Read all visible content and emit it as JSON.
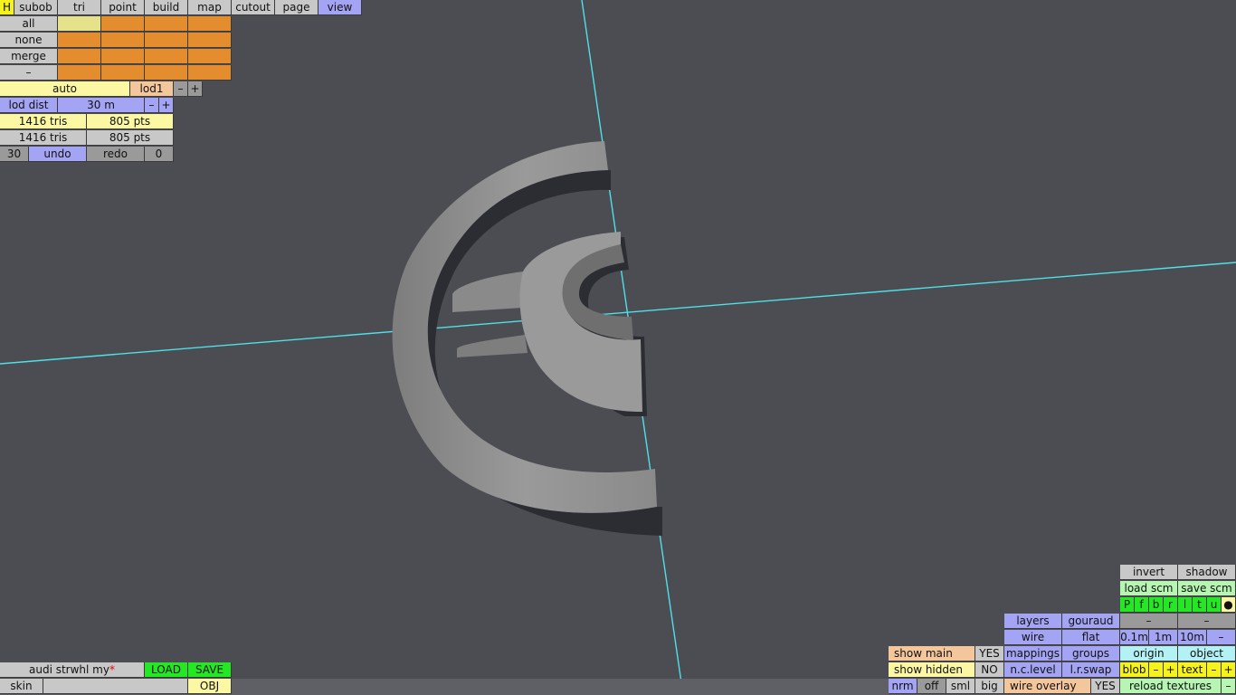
{
  "colors": {
    "viewport_bg": "#4b4d53",
    "axis_line": "#4fe0e8",
    "model": "#8f8f8f"
  },
  "top_menu": {
    "items": [
      "H",
      "subob",
      "tri",
      "point",
      "build",
      "map",
      "cutout",
      "page",
      "view"
    ],
    "active": "view"
  },
  "selection": {
    "rows": [
      "all",
      "none",
      "merge",
      "–"
    ]
  },
  "lod": {
    "mode": "auto",
    "level": "lod1",
    "minus": "–",
    "plus": "+",
    "dist_label": "lod dist",
    "dist_value": "30 m",
    "dist_minus": "–",
    "dist_plus": "+"
  },
  "stats": {
    "row1_tris": "1416 tris",
    "row1_pts": "805 pts",
    "row2_tris": "1416 tris",
    "row2_pts": "805 pts"
  },
  "history": {
    "undo_count": "30",
    "undo": "undo",
    "redo": "redo",
    "redo_count": "0"
  },
  "file": {
    "name": "audi strwhl my",
    "modified_marker": "*",
    "load": "LOAD",
    "save": "SAVE",
    "skin_label": "skin",
    "skin_value": "",
    "format": "OBJ"
  },
  "view_panel": {
    "invert": "invert",
    "shadow": "shadow",
    "load_scm": "load scm",
    "save_scm": "save scm",
    "cams": [
      "P",
      "f",
      "b",
      "r",
      "l",
      "t",
      "u",
      "●"
    ],
    "dash1": "–",
    "dash2": "–",
    "layers": "layers",
    "gouraud": "gouraud",
    "wire": "wire",
    "flat": "flat",
    "grid": [
      "0.1m",
      "1m",
      "10m",
      "–"
    ],
    "show_main": "show main",
    "show_main_val": "YES",
    "mappings": "mappings",
    "groups": "groups",
    "origin": "origin",
    "object": "object",
    "show_hidden": "show hidden",
    "show_hidden_val": "NO",
    "nc_level": "n.c.level",
    "lr_swap": "l.r.swap",
    "blob": "blob",
    "blob_minus": "–",
    "blob_plus": "+",
    "text": "text",
    "text_minus": "–",
    "text_plus": "+",
    "sizes": [
      "nrm",
      "off",
      "sml",
      "big"
    ],
    "wire_overlay": "wire overlay",
    "wire_overlay_val": "YES",
    "reload_textures": "reload textures",
    "reload_minus": "–"
  }
}
